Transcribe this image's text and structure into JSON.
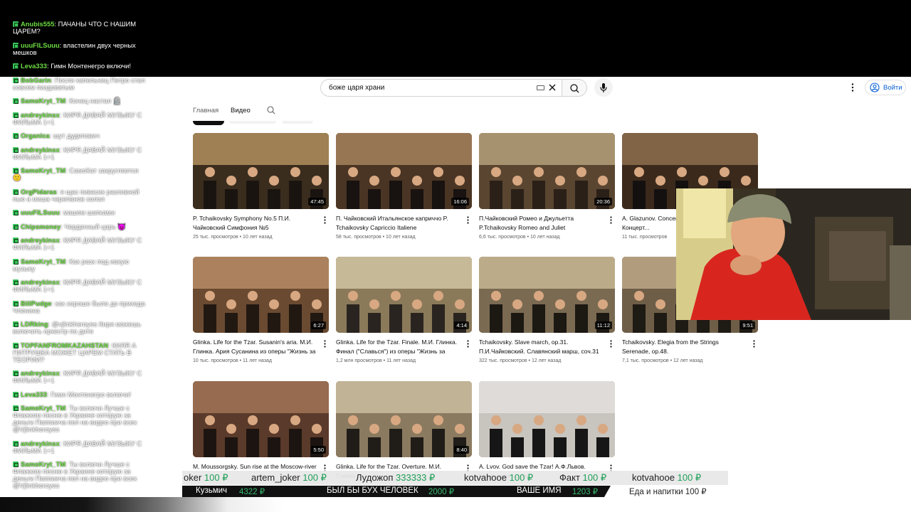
{
  "chat": [
    {
      "nick": "Anubis555",
      "text": "ПАЧАНЫ ЧТО С НАШИМ ЦАРЕМ?"
    },
    {
      "nick": "uuuFILSuuu",
      "text": "властелин двух черных мешков"
    },
    {
      "nick": "Leva333",
      "text": "Гимн Монтенегро включи!"
    },
    {
      "nick": "BobGarin",
      "text": "Посли капельниц Петро стал совсем пиздоватым"
    },
    {
      "nick": "SamoKryt_TM",
      "text": "Конец настал 🪦"
    },
    {
      "nick": "andreykinsx",
      "text": "КИРЯ ДАВАЙ МУЗЫКУ С ФИЛЬМА 1+1"
    },
    {
      "nick": "Organica",
      "text": "шут дудепович"
    },
    {
      "nick": "andreykinsx",
      "text": "КИРЯ ДАВАЙ МУЗЫКУ С ФИЛЬМА 1+1"
    },
    {
      "nick": "SamoKryt_TM",
      "text": "СамоКат закругляется 🙂"
    },
    {
      "nick": "OrgPidaras",
      "text": "я щас пивасик разливной пью а миша черепанов  холол"
    },
    {
      "nick": "uuuFILSuuu",
      "text": "машем шапками"
    },
    {
      "nick": "Chipsmoney",
      "text": "Чердачный царь 😈"
    },
    {
      "nick": "andreykinsx",
      "text": "КИРЯ ДАВАЙ МУЗЫКУ С ФИЛЬМА 1+1"
    },
    {
      "nick": "SamoKryt_TM",
      "text": "Как разх под иакую музыку"
    },
    {
      "nick": "andreykinsx",
      "text": "КИРЯ ДАВАЙ МУЗЫКУ С ФИЛЬМА 1+1"
    },
    {
      "nick": "BillPudge",
      "text": "как хорошо было до прихода Членина"
    },
    {
      "nick": "LDRking",
      "text": "@vjlinkheroyes Киря можешь включить оркестр по дите"
    },
    {
      "nick": "TOPFANFROMKAZAHSTAN",
      "text": "КИЛЯ А ПИТРУШКА МОЖЕТ ЦАРЕМ СТАТЬ В ТЕОРИИ?"
    },
    {
      "nick": "andreykinsx",
      "text": "КИРЯ ДАВАЙ МУЗЫКУ С ФИЛЬМА 1+1"
    },
    {
      "nick": "Leva333",
      "text": "Гимн Монтенегро включи!"
    },
    {
      "nick": "SamoKryt_TM",
      "text": "Ты включи Лучше с Флажком песню в Украине которую за деньги Паппиича пел на видео при  всех @Vjlinkheroyes"
    },
    {
      "nick": "andreykinsx",
      "text": "КИРЯ ДАВАЙ МУЗЫКУ С ФИЛЬМА 1+1"
    },
    {
      "nick": "SamoKryt_TM",
      "text": "Ты включи Лучше с Флажком песню в Украине которую за деньги Паппиича пел на видео при  всех @Vjlinkheroyes"
    }
  ],
  "youtube": {
    "search_value": "боже царя храни",
    "signin_label": "Войти",
    "tabs": {
      "home": "Главная",
      "videos": "Видео"
    }
  },
  "videos": [
    {
      "title": "P. Tchaikovsky Symphony No.5 П.И. Чайковский Симфония №5",
      "views": "25 тыс. просмотров",
      "age": "10 лет назад",
      "duration": "47:45"
    },
    {
      "title": "П. Чайковский Итальянское каприччо P. Tchaikovsky Capriccio Italiene",
      "views": "58 тыс. просмотров",
      "age": "10 лет назад",
      "duration": "16:06"
    },
    {
      "title": "П.Чайковский Ромео и Джульетта P.Tchaikovsky Romeo and Juliet",
      "views": "6,6 тыс. просмотров",
      "age": "10 лет назад",
      "duration": "20:36"
    },
    {
      "title": "A. Glazunov. Concerto... А.К.Глазунов. Концерт...",
      "views": "11 тыс. просмотров",
      "age": "",
      "duration": ""
    },
    {
      "title": "Glinka. Life for the Tzar. Susanin's aria. М.И. Глинка. Ария Сусанина из оперы \"Жизнь за царя\"",
      "views": "10 тыс. просмотров",
      "age": "11 лет назад",
      "duration": "6:27"
    },
    {
      "title": "Glinka. Life for the Tzar. Finale. М.И. Глинка. Финал (\"Славься\") из оперы \"Жизнь за царя\"",
      "views": "1,2 млн просмотров",
      "age": "11 лет назад",
      "duration": "4:14"
    },
    {
      "title": "Tchaikovsky. Slave march, op.31. П.И.Чайковский. Славянский марш, соч.31",
      "views": "322 тыс. просмотров",
      "age": "12 лет назад",
      "duration": "11:12"
    },
    {
      "title": "Tchaikovsky. Elegia from the Strings Serenade, op.48.",
      "views": "7,1 тыс. просмотров",
      "age": "12 лет назад",
      "duration": "9:51"
    },
    {
      "title": "M. Moussorgsky. Sun rise at the Moscow-river",
      "views": "",
      "age": "",
      "duration": "5:50"
    },
    {
      "title": "Glinka. Life for the Tzar. Overture. М.И. Глинка",
      "views": "",
      "age": "",
      "duration": "8:40"
    },
    {
      "title": "A. Lvov. God save the Tzar! А.Ф.Львов. Боже, царя храни!",
      "views": "",
      "age": "",
      "duration": ""
    }
  ],
  "ticker": [
    {
      "name": "oker",
      "amount": "100 ₽"
    },
    {
      "name": "artem_joker",
      "amount": "100 ₽"
    },
    {
      "name": "Лудожоп",
      "amount": "333333 ₽"
    },
    {
      "name": "kotvahooe",
      "amount": "100 ₽"
    },
    {
      "name": "Факт",
      "amount": "100 ₽"
    },
    {
      "name": "kotvahooe",
      "amount": "100 ₽"
    }
  ],
  "donations": [
    {
      "name": "Кузьмич",
      "amount": "4322 ₽"
    },
    {
      "name": "БЫЛ БЫ БУХ ЧЕЛОВЕК",
      "amount": "2000 ₽"
    },
    {
      "name": "ВАШЕ ИМЯ",
      "amount": "1203 ₽"
    }
  ],
  "donation_extra": "Еда и напитки 100 ₽",
  "colors": {
    "nick": "#6ddc43",
    "ticker_amount": "#1e9e57",
    "signin": "#065fd4"
  }
}
